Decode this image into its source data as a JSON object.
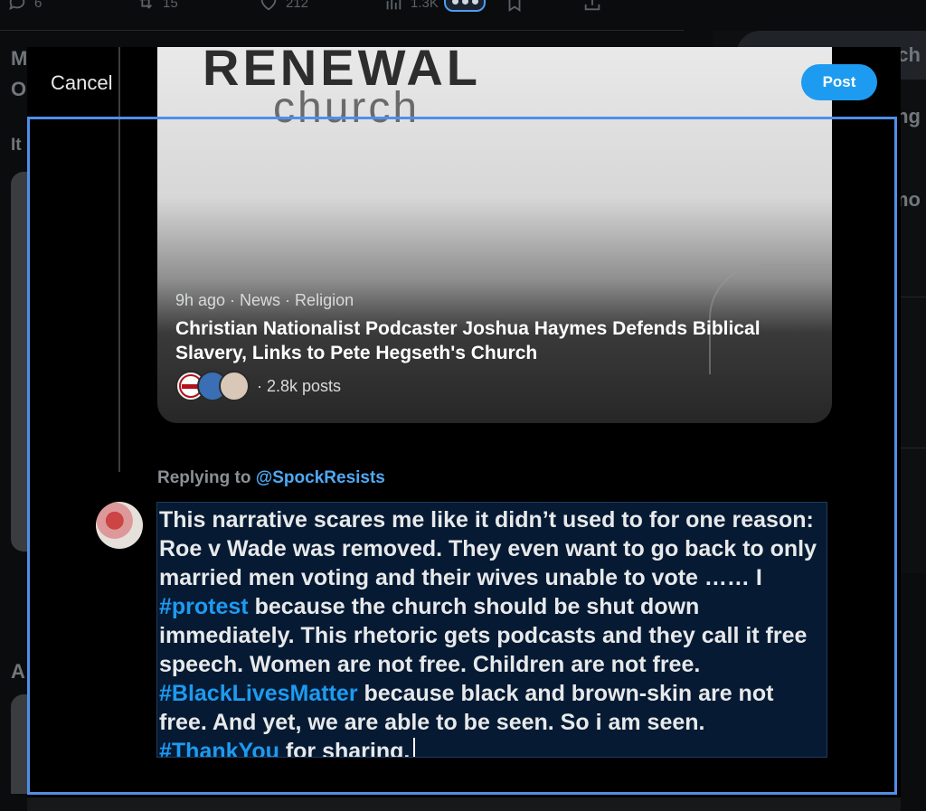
{
  "background_feed": {
    "action_counts": [
      "6",
      "15",
      "212",
      "1.3K"
    ],
    "left_letters": [
      "M",
      "O",
      "It",
      "A"
    ],
    "right_texts": [
      "rch",
      "ng",
      "mo"
    ]
  },
  "modal": {
    "cancel_label": "Cancel",
    "post_label": "Post",
    "card": {
      "logo_top": "RENEWAL",
      "logo_bottom": "church",
      "meta": "9h ago · News · Religion",
      "title": "Christian Nationalist Podcaster Joshua Haymes Defends Biblical Slavery, Links to Pete Hegseth's Church",
      "avatar1_text": "RIGHT WING WATCH",
      "posts": "· 2.8k posts"
    },
    "replying_prefix": "Replying to ",
    "replying_handle": "@SpockResists",
    "compose": {
      "part1": "This narrative scares me like it didn’t used to for one reason: Roe v Wade was removed. They even want to go back to only married men voting and their wives unable to vote …… I ",
      "tag1": "#protest",
      "part2": " because the church should be shut down immediately. This rhetoric gets podcasts and they call it free speech. Women are not free. Children are not free. ",
      "tag2": "#BlackLivesMatter",
      "part3": " because black and brown-skin are not free. And yet, we are able to be seen. So i am seen. ",
      "tag3": "#ThankYou",
      "part4": " for sharing."
    }
  },
  "colors": {
    "accent": "#1d9bf0",
    "focus": "#4f8fe9",
    "compose_bg": "#061a33"
  }
}
